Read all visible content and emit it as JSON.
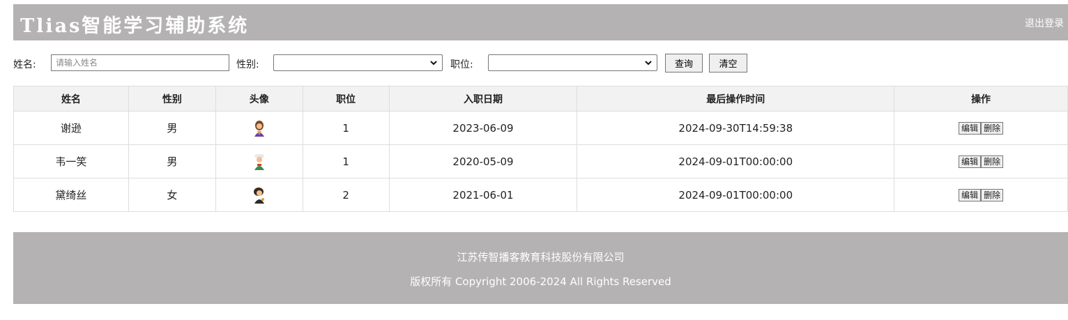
{
  "header": {
    "title": "Tlias智能学习辅助系统",
    "logout": "退出登录"
  },
  "search": {
    "name_label": "姓名:",
    "name_placeholder": "请输入姓名",
    "name_value": "",
    "gender_label": "性别:",
    "gender_value": "",
    "job_label": "职位:",
    "job_value": "",
    "query_button": "查询",
    "clear_button": "清空"
  },
  "table": {
    "columns": [
      "姓名",
      "性别",
      "头像",
      "职位",
      "入职日期",
      "最后操作时间",
      "操作"
    ],
    "rows": [
      {
        "name": "谢逊",
        "gender": "男",
        "avatar": "avatar-icon",
        "job": "1",
        "entry_date": "2023-06-09",
        "update_time": "2024-09-30T14:59:38"
      },
      {
        "name": "韦一笑",
        "gender": "男",
        "avatar": "avatar-icon",
        "job": "1",
        "entry_date": "2020-05-09",
        "update_time": "2024-09-01T00:00:00"
      },
      {
        "name": "黛绮丝",
        "gender": "女",
        "avatar": "avatar-icon",
        "job": "2",
        "entry_date": "2021-06-01",
        "update_time": "2024-09-01T00:00:00"
      }
    ],
    "edit_label": "编辑",
    "delete_label": "删除"
  },
  "footer": {
    "company": "江苏传智播客教育科技股份有限公司",
    "copyright": "版权所有 Copyright 2006-2024 All Rights Reserved"
  },
  "colors": {
    "header_bg": "#b4b2b3",
    "footer_bg": "#b4b2b3",
    "table_header_bg": "#f2f2f2"
  }
}
